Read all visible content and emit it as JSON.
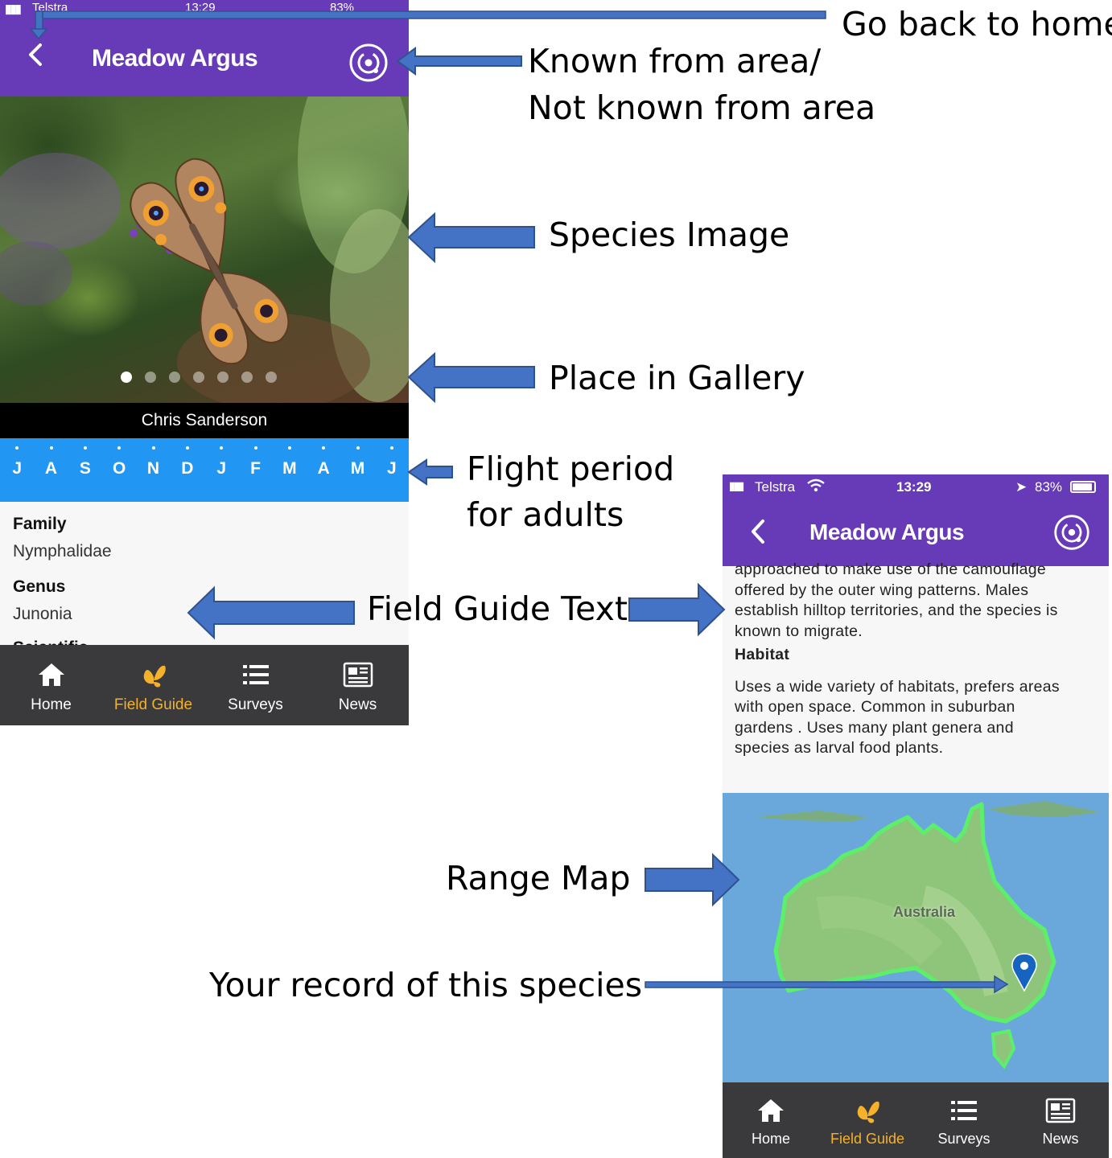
{
  "annotations": {
    "go_back": "Go back to home",
    "known_line1": "Known from area/",
    "known_line2": "Not known from area",
    "species_image": "Species Image",
    "place_in_gallery": "Place in Gallery",
    "flight_line1": "Flight period",
    "flight_line2": "for adults",
    "field_guide_text": "Field Guide Text",
    "range_map": "Range Map",
    "your_record": "Your record of this species"
  },
  "phone1": {
    "status": {
      "carrier": "Telstra",
      "time": "13:29",
      "battery": "83%"
    },
    "header": {
      "title": "Meadow Argus"
    },
    "gallery": {
      "count": 7,
      "active_index": 0,
      "credit": "Chris Sanderson"
    },
    "flight_period": {
      "months": [
        "J",
        "A",
        "S",
        "O",
        "N",
        "D",
        "J",
        "F",
        "M",
        "A",
        "M",
        "J"
      ]
    },
    "info": {
      "family_label": "Family",
      "family_value": "Nymphalidae",
      "genus_label": "Genus",
      "genus_value": "Junonia",
      "scientific_label": "Scientific"
    }
  },
  "phone2": {
    "status": {
      "carrier": "Telstra",
      "time": "13:29",
      "battery": "83%"
    },
    "header": {
      "title": "Meadow Argus"
    },
    "text": {
      "line1": "approached to make use of the camouflage",
      "line2": "offered by the outer wing patterns. Males",
      "line3": "establish hilltop territories, and the species is",
      "line4": "known to migrate.",
      "habitat_label": "Habitat",
      "hab1": "Uses a wide variety of habitats, prefers areas",
      "hab2": "with open space. Common in suburban",
      "hab3": "gardens . Uses many plant genera and",
      "hab4": "species as larval food plants."
    },
    "map": {
      "label": "Australia"
    }
  },
  "tabs": [
    {
      "label": "Home",
      "icon": "home-icon",
      "active": false
    },
    {
      "label": "Field Guide",
      "icon": "butterfly-icon",
      "active": true
    },
    {
      "label": "Surveys",
      "icon": "list-icon",
      "active": false
    },
    {
      "label": "News",
      "icon": "newspaper-icon",
      "active": false
    }
  ],
  "colors": {
    "header_purple": "#673ab7",
    "flight_blue": "#2196f3",
    "tab_active": "#f5b12a",
    "tab_bar": "#3a3a3c",
    "range_green": "#5cf06a",
    "arrow_blue": "#4472c4"
  }
}
